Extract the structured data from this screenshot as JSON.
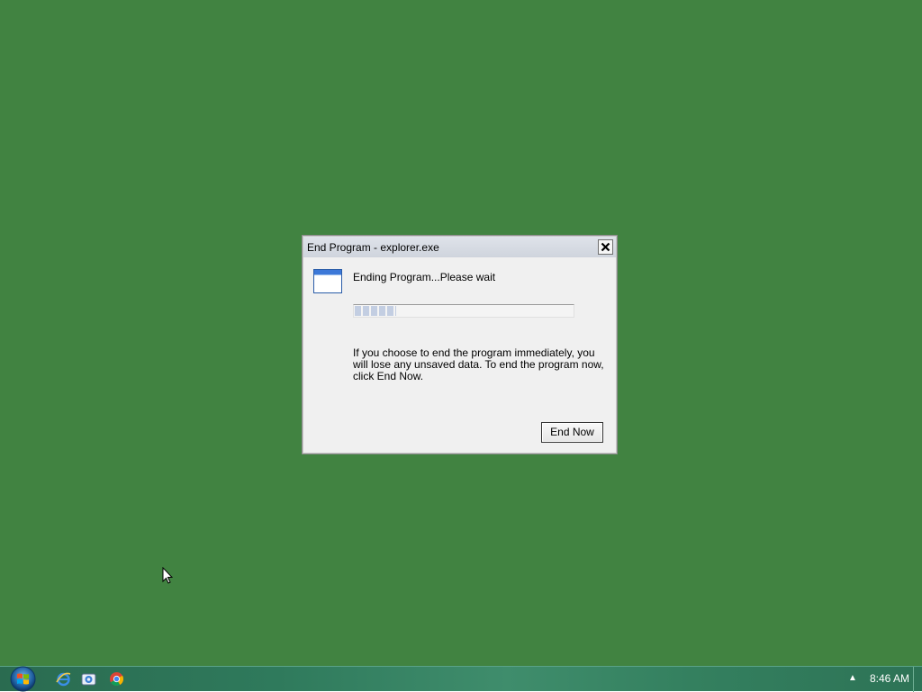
{
  "desktop": {
    "background_color": "#418341"
  },
  "dialog": {
    "title": "End Program - explorer.exe",
    "close_icon": "close-icon",
    "program_icon": "window-icon",
    "message": "Ending Program...Please wait",
    "progress": {
      "fraction_filled": 0.19
    },
    "warning": "If you choose to end the program immediately, you will lose any unsaved data. To end the program now, click End Now.",
    "end_now_label": "End Now"
  },
  "taskbar": {
    "start_icon": "windows-start-icon",
    "pinned": [
      {
        "name": "internet-explorer-icon"
      },
      {
        "name": "windows-explorer-icon"
      },
      {
        "name": "chrome-icon"
      }
    ],
    "tray_arrow": "▲",
    "clock": "8:46 AM",
    "accent_color": "#2f7a5c"
  }
}
